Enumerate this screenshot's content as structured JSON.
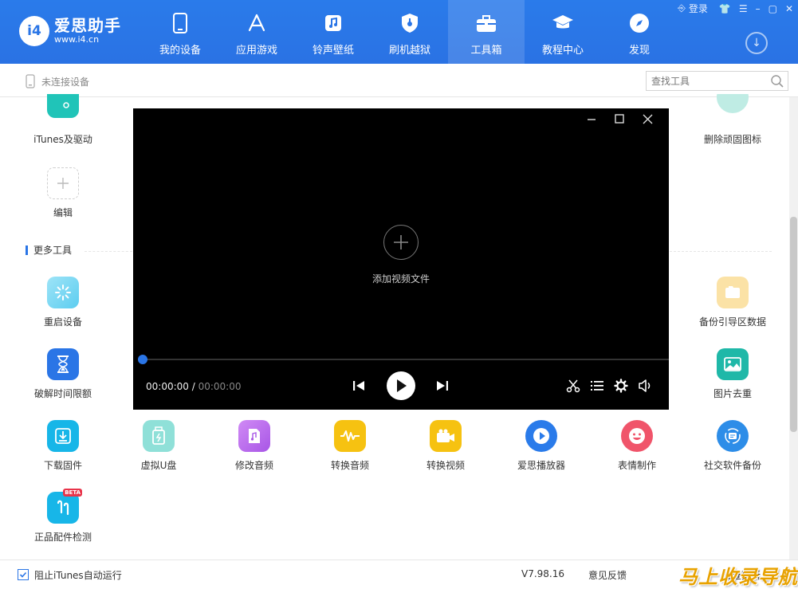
{
  "app": {
    "logo_badge": "i4",
    "logo_name": "爱思助手",
    "logo_url": "www.i4.cn"
  },
  "nav": [
    {
      "label": "我的设备",
      "icon": "phone-icon"
    },
    {
      "label": "应用游戏",
      "icon": "app-store-icon"
    },
    {
      "label": "铃声壁纸",
      "icon": "ringtone-icon"
    },
    {
      "label": "刷机越狱",
      "icon": "shield-icon"
    },
    {
      "label": "工具箱",
      "icon": "toolbox-icon",
      "active": true
    },
    {
      "label": "教程中心",
      "icon": "graduation-cap-icon"
    },
    {
      "label": "发现",
      "icon": "compass-icon"
    }
  ],
  "window": {
    "login": "登录"
  },
  "subbar": {
    "device_status": "未连接设备",
    "search_placeholder": "查找工具"
  },
  "tools": {
    "itunes": "iTunes及驱动",
    "edit": "编辑",
    "delete_icons": "删除顽固图标",
    "section_more": "更多工具",
    "restart": "重启设备",
    "backup_boot": "备份引导区数据",
    "crack_time": "破解时间限额",
    "image_dedup": "图片去重",
    "row3": [
      {
        "label": "下载固件",
        "color": "#17b6e8"
      },
      {
        "label": "虚拟U盘",
        "color": "#5fd0c6"
      },
      {
        "label": "修改音频",
        "color": "#b668e8"
      },
      {
        "label": "转换音频",
        "color": "#f6c211"
      },
      {
        "label": "转换视频",
        "color": "#f6c211"
      },
      {
        "label": "爱思播放器",
        "color": "#2a7bea"
      },
      {
        "label": "表情制作",
        "color": "#f0546a"
      },
      {
        "label": "社交软件备份",
        "color": "#2d8de8"
      }
    ],
    "accessory_check": "正品配件检测",
    "beta_badge": "BETA"
  },
  "player": {
    "add_video": "添加视频文件",
    "current_time": "00:00:00",
    "separator": " / ",
    "total_time": "00:00:00",
    "progress": 0
  },
  "footer": {
    "block_itunes": "阻止iTunes自动运行",
    "version": "V7.98.16",
    "feedback": "意见反馈",
    "check_update": "检查更新",
    "watermark": "马上收录导航"
  }
}
